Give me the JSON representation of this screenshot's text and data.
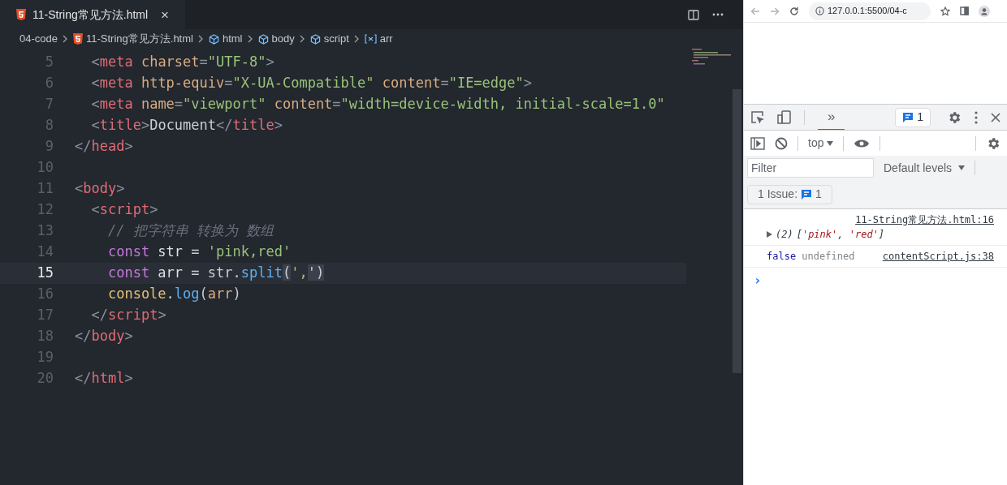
{
  "editor": {
    "tab": {
      "title": "11-String常见方法.html",
      "close": "×",
      "selected": true
    },
    "breadcrumbs": [
      {
        "kind": "folder",
        "label": "04-code"
      },
      {
        "kind": "html",
        "label": "11-String常见方法.html"
      },
      {
        "kind": "element",
        "label": "html"
      },
      {
        "kind": "element",
        "label": "body"
      },
      {
        "kind": "element",
        "label": "script"
      },
      {
        "kind": "variable",
        "label": "arr"
      }
    ],
    "lines": [
      {
        "number": "5",
        "current": false,
        "tokens": [
          {
            "kind": "punct",
            "text": "  <"
          },
          {
            "kind": "tag",
            "text": "meta"
          },
          {
            "kind": "attr",
            "text": " charset"
          },
          {
            "kind": "punct",
            "text": "="
          },
          {
            "kind": "string",
            "text": "\"UTF-8\""
          },
          {
            "kind": "punct",
            "text": ">"
          }
        ]
      },
      {
        "number": "6",
        "current": false,
        "tokens": [
          {
            "kind": "punct",
            "text": "  <"
          },
          {
            "kind": "tag",
            "text": "meta"
          },
          {
            "kind": "attr",
            "text": " http-equiv"
          },
          {
            "kind": "punct",
            "text": "="
          },
          {
            "kind": "string",
            "text": "\"X-UA-Compatible\""
          },
          {
            "kind": "attr",
            "text": " content"
          },
          {
            "kind": "punct",
            "text": "="
          },
          {
            "kind": "string",
            "text": "\"IE=edge\""
          },
          {
            "kind": "punct",
            "text": ">"
          }
        ]
      },
      {
        "number": "7",
        "current": false,
        "tokens": [
          {
            "kind": "punct",
            "text": "  <"
          },
          {
            "kind": "tag",
            "text": "meta"
          },
          {
            "kind": "attr",
            "text": " name"
          },
          {
            "kind": "punct",
            "text": "="
          },
          {
            "kind": "string",
            "text": "\"viewport\""
          },
          {
            "kind": "attr",
            "text": " content"
          },
          {
            "kind": "punct",
            "text": "="
          },
          {
            "kind": "string",
            "text": "\"width=device-width, initial-scale=1.0\""
          }
        ]
      },
      {
        "number": "8",
        "current": false,
        "tokens": [
          {
            "kind": "punct",
            "text": "  <"
          },
          {
            "kind": "tag",
            "text": "title"
          },
          {
            "kind": "punct",
            "text": ">"
          },
          {
            "kind": "plain",
            "text": "Document"
          },
          {
            "kind": "punct",
            "text": "</"
          },
          {
            "kind": "tag",
            "text": "title"
          },
          {
            "kind": "punct",
            "text": ">"
          }
        ]
      },
      {
        "number": "9",
        "current": false,
        "tokens": [
          {
            "kind": "punct",
            "text": "</"
          },
          {
            "kind": "tag",
            "text": "head"
          },
          {
            "kind": "punct",
            "text": ">"
          }
        ]
      },
      {
        "number": "10",
        "current": false
      },
      {
        "number": "11",
        "current": false,
        "tokens": [
          {
            "kind": "punct",
            "text": "<"
          },
          {
            "kind": "tag",
            "text": "body"
          },
          {
            "kind": "punct",
            "text": ">"
          }
        ]
      },
      {
        "number": "12",
        "current": false,
        "tokens": [
          {
            "kind": "punct",
            "text": "  <"
          },
          {
            "kind": "tag",
            "text": "script"
          },
          {
            "kind": "punct",
            "text": ">"
          }
        ]
      },
      {
        "number": "13",
        "current": false,
        "tokens": [
          {
            "kind": "comment",
            "text": "    // 把字符串 转换为 数组"
          }
        ]
      },
      {
        "number": "14",
        "current": false,
        "tokens": [
          {
            "kind": "keyword",
            "text": "    const"
          },
          {
            "kind": "variable",
            "text": " str"
          },
          {
            "kind": "plain",
            "text": " = "
          },
          {
            "kind": "string",
            "text": "'pink,red'"
          }
        ]
      },
      {
        "number": "15",
        "current": true,
        "tokens": [
          {
            "kind": "keyword",
            "text": "    const"
          },
          {
            "kind": "variable",
            "text": " arr"
          },
          {
            "kind": "plain",
            "text": " = str."
          },
          {
            "kind": "function",
            "text": "split"
          },
          {
            "kind": "bracket",
            "text": "("
          },
          {
            "kind": "string",
            "text": "',"
          },
          {
            "kind": "bracket",
            "text": "')"
          }
        ]
      },
      {
        "number": "16",
        "current": false,
        "tokens": [
          {
            "kind": "object",
            "text": "    console"
          },
          {
            "kind": "plain",
            "text": "."
          },
          {
            "kind": "function",
            "text": "log"
          },
          {
            "kind": "plain",
            "text": "("
          },
          {
            "kind": "param",
            "text": "arr"
          },
          {
            "kind": "plain",
            "text": ")"
          }
        ]
      },
      {
        "number": "17",
        "current": false,
        "tokens": [
          {
            "kind": "punct",
            "text": "  </"
          },
          {
            "kind": "tag",
            "text": "script"
          },
          {
            "kind": "punct",
            "text": ">"
          }
        ]
      },
      {
        "number": "18",
        "current": false,
        "tokens": [
          {
            "kind": "punct",
            "text": "</"
          },
          {
            "kind": "tag",
            "text": "body"
          },
          {
            "kind": "punct",
            "text": ">"
          }
        ]
      },
      {
        "number": "19",
        "current": false
      },
      {
        "number": "20",
        "current": false,
        "tokens": [
          {
            "kind": "punct",
            "text": "</"
          },
          {
            "kind": "tag",
            "text": "html"
          },
          {
            "kind": "punct",
            "text": ">"
          }
        ]
      }
    ]
  },
  "browser": {
    "url": "127.0.0.1:5500/04-c",
    "devtools": {
      "more_tabs": "»",
      "issues_badge": "1",
      "context": "top",
      "filter_placeholder": "Filter",
      "levels": "Default levels",
      "issues_label": "1 Issue:",
      "issues_count": "1",
      "messages": [
        {
          "kind": "log",
          "source": "11-String常见方法.html:16",
          "count": "(2)",
          "value": [
            {
              "kind": "punct",
              "text": "["
            },
            {
              "kind": "string",
              "text": "'pink'"
            },
            {
              "kind": "punct",
              "text": ", "
            },
            {
              "kind": "string",
              "text": "'red'"
            },
            {
              "kind": "punct",
              "text": "]"
            }
          ]
        },
        {
          "kind": "values",
          "value": [
            {
              "kind": "boolean",
              "text": "false"
            },
            {
              "kind": "undefined",
              "text": " undefined"
            }
          ],
          "source": "contentScript.js:38"
        }
      ],
      "prompt": "›"
    }
  }
}
